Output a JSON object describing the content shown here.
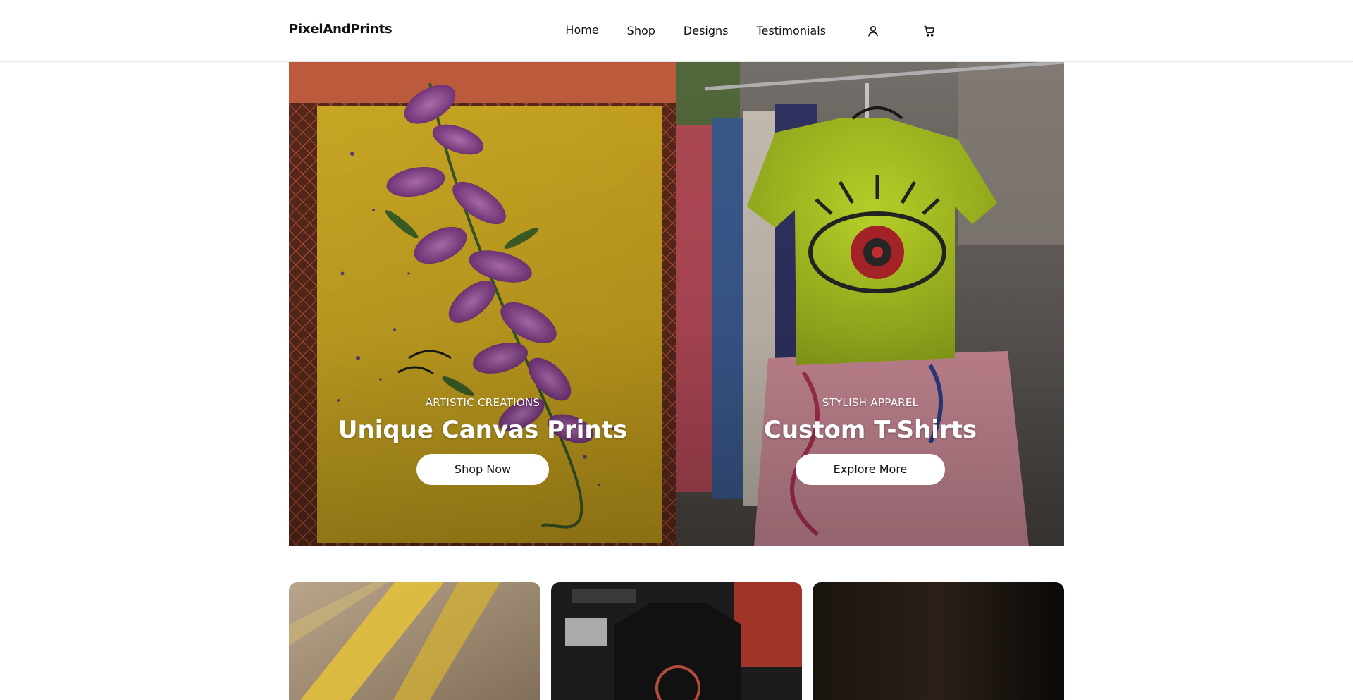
{
  "brand": "PixelAndPrints",
  "nav": {
    "items": [
      {
        "label": "Home",
        "active": true
      },
      {
        "label": "Shop",
        "active": false
      },
      {
        "label": "Designs",
        "active": false
      },
      {
        "label": "Testimonials",
        "active": false
      }
    ],
    "icons": [
      "user-icon",
      "cart-icon"
    ]
  },
  "hero": {
    "left": {
      "eyebrow": "ARTISTIC CREATIONS",
      "title": "Unique Canvas Prints",
      "button": "Shop Now"
    },
    "right": {
      "eyebrow": "STYLISH APPAREL",
      "title": "Custom T-Shirts",
      "button": "Explore More"
    }
  },
  "colors": {
    "text": "#111111",
    "background": "#ffffff",
    "button_bg": "#ffffff"
  }
}
